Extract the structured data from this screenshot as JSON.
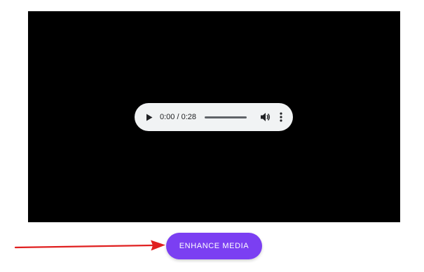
{
  "media": {
    "background_color": "#000000",
    "player": {
      "play_icon": "play-icon",
      "time_text": "0:00 / 0:28",
      "progress": 0,
      "volume_icon": "volume-icon",
      "menu_icon": "more-vert-icon"
    }
  },
  "actions": {
    "enhance_label": "ENHANCE MEDIA",
    "enhance_color": "#7b3ff2"
  },
  "annotation": {
    "arrow_icon": "arrow-right-icon",
    "arrow_color": "#e02020"
  }
}
